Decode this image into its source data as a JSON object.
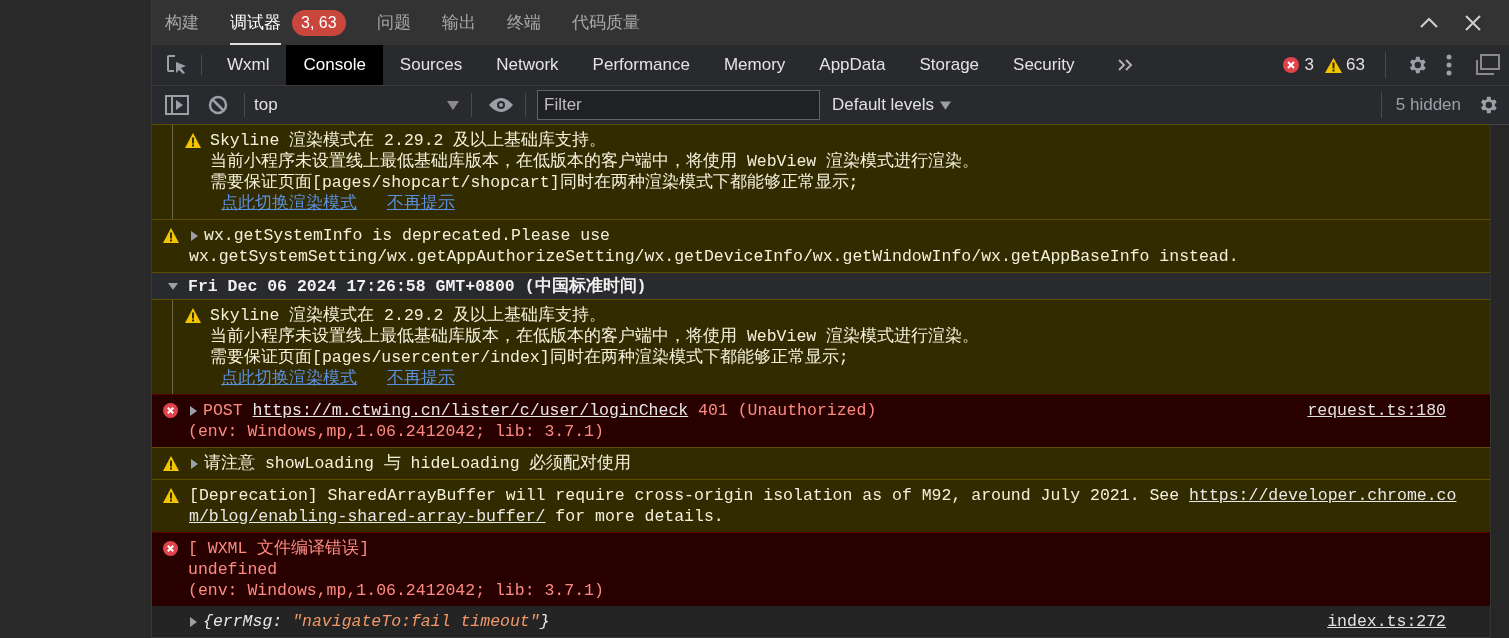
{
  "top_tabs": [
    {
      "label": "构建",
      "selected": false
    },
    {
      "label": "调试器",
      "selected": true,
      "badge": "3, 63"
    },
    {
      "label": "问题",
      "selected": false
    },
    {
      "label": "输出",
      "selected": false
    },
    {
      "label": "终端",
      "selected": false
    },
    {
      "label": "代码质量",
      "selected": false
    }
  ],
  "devtools_tabs": [
    {
      "label": "Wxml",
      "selected": false
    },
    {
      "label": "Console",
      "selected": true
    },
    {
      "label": "Sources",
      "selected": false
    },
    {
      "label": "Network",
      "selected": false
    },
    {
      "label": "Performance",
      "selected": false
    },
    {
      "label": "Memory",
      "selected": false
    },
    {
      "label": "AppData",
      "selected": false
    },
    {
      "label": "Storage",
      "selected": false
    },
    {
      "label": "Security",
      "selected": false
    }
  ],
  "issue_counts": {
    "errors": "3",
    "warnings": "63"
  },
  "toolbar": {
    "context": "top",
    "filter_placeholder": "Filter",
    "levels": "Default levels",
    "hidden": "5 hidden"
  },
  "messages": [
    {
      "kind": "group",
      "children": [
        {
          "kind": "warning",
          "lines": [
            [
              {
                "text": "Skyline 渲染模式在 2.29.2 及以上基础库支持。"
              }
            ],
            [
              {
                "text": "当前小程序未设置线上最低基础库版本，在低版本的客户端中，将使用 WebView 渲染模式进行渲染。"
              }
            ],
            [
              {
                "text": "需要保证页面[pages/shopcart/shopcart]同时在两种渲染模式下都能够正常显示;"
              }
            ]
          ],
          "actions": [
            "点此切换渲染模式",
            "不再提示"
          ]
        }
      ]
    },
    {
      "kind": "warning",
      "expanded": false,
      "lines": [
        [
          {
            "text": "wx.getSystemInfo is deprecated.Please use"
          }
        ],
        [
          {
            "text": "wx.getSystemSetting/wx.getAppAuthorizeSetting/wx.getDeviceInfo/wx.getWindowInfo/wx.getAppBaseInfo instead."
          }
        ]
      ]
    },
    {
      "kind": "group",
      "title": "Fri Dec 06 2024 17:26:58 GMT+0800 (中国标准时间)",
      "expanded": true,
      "children": [
        {
          "kind": "warning",
          "lines": [
            [
              {
                "text": "Skyline 渲染模式在 2.29.2 及以上基础库支持。"
              }
            ],
            [
              {
                "text": "当前小程序未设置线上最低基础库版本，在低版本的客户端中，将使用 WebView 渲染模式进行渲染。"
              }
            ],
            [
              {
                "text": "需要保证页面[pages/usercenter/index]同时在两种渲染模式下都能够正常显示;"
              }
            ]
          ],
          "actions": [
            "点此切换渲染模式",
            "不再提示"
          ]
        }
      ]
    },
    {
      "kind": "error",
      "expanded": false,
      "lines": [
        [
          {
            "text": "POST "
          },
          {
            "text": "https://m.ctwing.cn/lister/c/user/loginCheck",
            "kind": "link"
          },
          {
            "text": " 401 (Unauthorized)"
          }
        ],
        [
          {
            "text": "(env: Windows,mp,1.06.2412042; lib: 3.7.1)"
          }
        ]
      ],
      "source": "request.ts:180"
    },
    {
      "kind": "warning",
      "expanded": false,
      "lines": [
        [
          {
            "text": "请注意 showLoading 与 hideLoading 必须配对使用"
          }
        ]
      ]
    },
    {
      "kind": "warning",
      "lines": [
        [
          {
            "text": "[Deprecation] SharedArrayBuffer will require cross-origin isolation as of M92, around July 2021. See "
          },
          {
            "text": "https://developer.chrome.co",
            "kind": "link"
          }
        ],
        [
          {
            "text": "m/blog/enabling-shared-array-buffer/",
            "kind": "link"
          },
          {
            "text": " for more details."
          }
        ]
      ]
    },
    {
      "kind": "error",
      "lines": [
        [
          {
            "text": "[ WXML 文件编译错误]"
          }
        ],
        [
          {
            "text": "undefined"
          }
        ],
        [
          {
            "text": "(env: Windows,mp,1.06.2412042; lib: 3.7.1)"
          }
        ]
      ]
    },
    {
      "kind": "log",
      "expanded": false,
      "lines": [
        [
          {
            "text": "{errMsg: "
          },
          {
            "text": "\"navigateTo:fail timeout\"",
            "kind": "string"
          },
          {
            "text": "}"
          }
        ]
      ],
      "source": "index.ts:272"
    }
  ]
}
